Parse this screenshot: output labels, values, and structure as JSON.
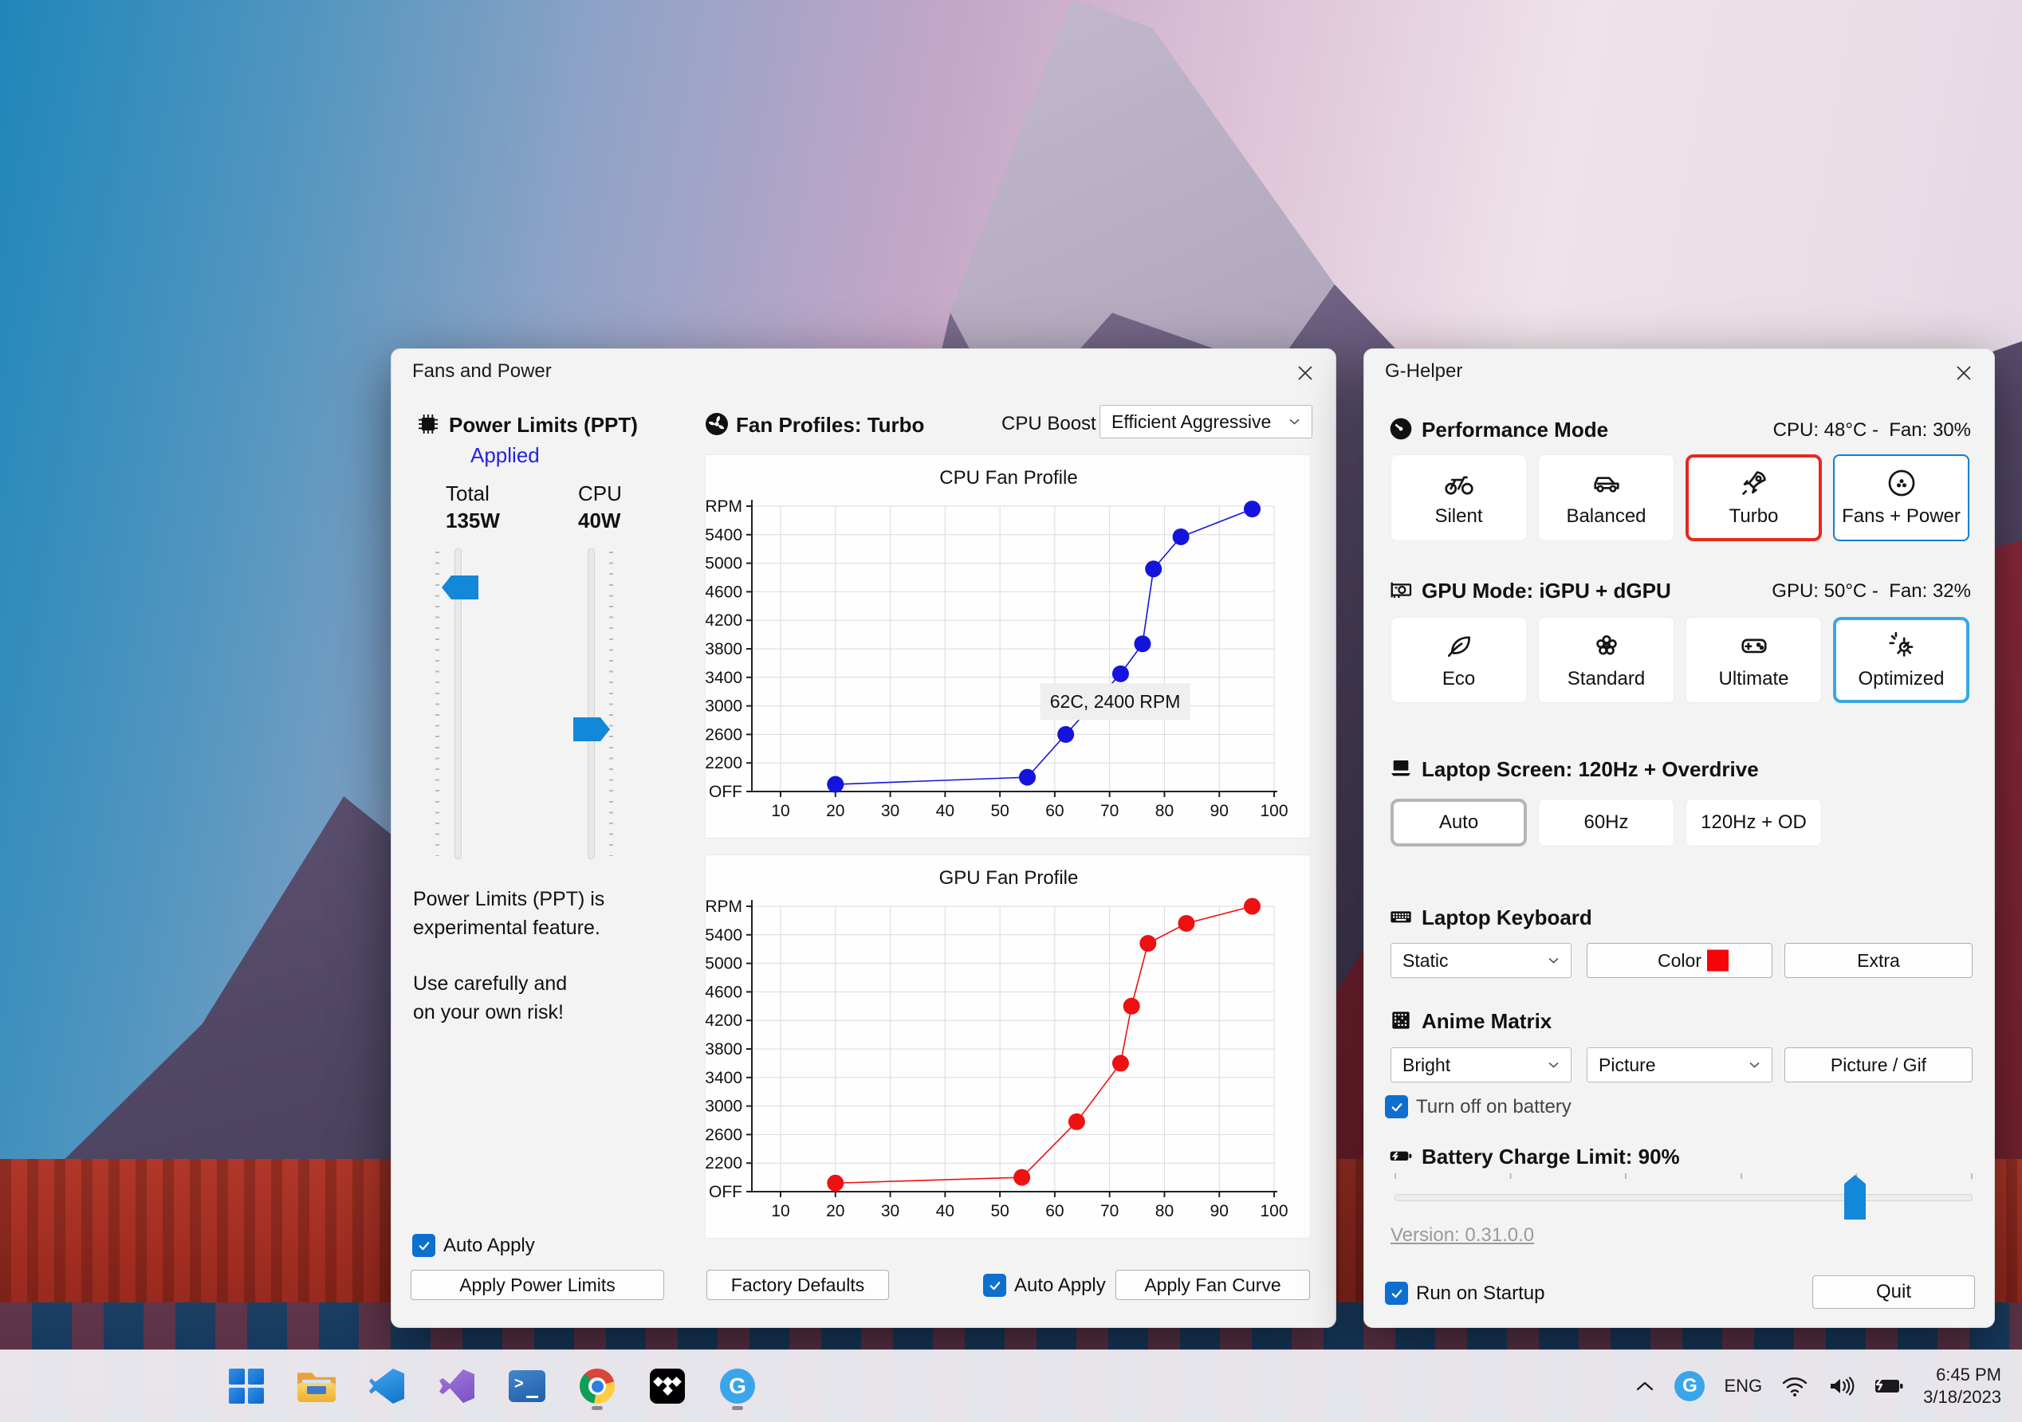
{
  "fans_window": {
    "title": "Fans and Power",
    "power": {
      "header": "Power Limits (PPT)",
      "status": "Applied",
      "total_label": "Total",
      "total_value": "135W",
      "cpu_label": "CPU",
      "cpu_value": "40W",
      "warning_line1": "Power Limits (PPT) is",
      "warning_line2": "experimental feature.",
      "warning_line3": "Use carefully and",
      "warning_line4": "on your own risk!",
      "auto_apply_label": "Auto Apply",
      "apply_button": "Apply Power Limits"
    },
    "profiles": {
      "header": "Fan Profiles: Turbo",
      "cpu_boost_label": "CPU Boost",
      "cpu_boost_value": "Efficient Aggressive",
      "factory_defaults_button": "Factory Defaults",
      "auto_apply_label": "Auto Apply",
      "apply_fan_curve_button": "Apply Fan Curve"
    }
  },
  "chart_data": [
    {
      "type": "line",
      "title": "CPU Fan Profile",
      "xlabel": "",
      "ylabel": "RPM",
      "grid": true,
      "x_ticks": [
        10,
        20,
        30,
        40,
        50,
        60,
        70,
        80,
        90,
        100
      ],
      "y_ticks": [
        {
          "label": "OFF",
          "value": 1800
        },
        {
          "label": "2200",
          "value": 2200
        },
        {
          "label": "2600",
          "value": 2600
        },
        {
          "label": "3000",
          "value": 3000
        },
        {
          "label": "3400",
          "value": 3400
        },
        {
          "label": "3800",
          "value": 3800
        },
        {
          "label": "4200",
          "value": 4200
        },
        {
          "label": "4600",
          "value": 4600
        },
        {
          "label": "5000",
          "value": 5000
        },
        {
          "label": "5400",
          "value": 5400
        },
        {
          "label": "RPM",
          "value": 5800
        }
      ],
      "series": [
        {
          "name": "CPU fan curve",
          "color": "#1414dd",
          "points": [
            [
              20,
              1900
            ],
            [
              55,
              2000
            ],
            [
              62,
              2600
            ],
            [
              72,
              3450
            ],
            [
              76,
              3870
            ],
            [
              78,
              4920
            ],
            [
              83,
              5370
            ],
            [
              96,
              5760
            ]
          ]
        }
      ],
      "annotation": {
        "text": "62C, 2400 RPM",
        "x": 71,
        "y": 3060
      }
    },
    {
      "type": "line",
      "title": "GPU Fan Profile",
      "xlabel": "",
      "ylabel": "RPM",
      "grid": true,
      "x_ticks": [
        10,
        20,
        30,
        40,
        50,
        60,
        70,
        80,
        90,
        100
      ],
      "y_ticks": [
        {
          "label": "OFF",
          "value": 1800
        },
        {
          "label": "2200",
          "value": 2200
        },
        {
          "label": "2600",
          "value": 2600
        },
        {
          "label": "3000",
          "value": 3000
        },
        {
          "label": "3400",
          "value": 3400
        },
        {
          "label": "3800",
          "value": 3800
        },
        {
          "label": "4200",
          "value": 4200
        },
        {
          "label": "4600",
          "value": 4600
        },
        {
          "label": "5000",
          "value": 5000
        },
        {
          "label": "5400",
          "value": 5400
        },
        {
          "label": "RPM",
          "value": 5800
        }
      ],
      "series": [
        {
          "name": "GPU fan curve",
          "color": "#ee1111",
          "points": [
            [
              20,
              1920
            ],
            [
              54,
              2000
            ],
            [
              64,
              2780
            ],
            [
              72,
              3600
            ],
            [
              74,
              4400
            ],
            [
              77,
              5280
            ],
            [
              84,
              5560
            ],
            [
              96,
              5800
            ]
          ]
        }
      ]
    }
  ],
  "ghelper_window": {
    "title": "G-Helper",
    "performance": {
      "header": "Performance Mode",
      "status": "CPU: 48°C -  Fan: 30%",
      "buttons": [
        {
          "label": "Silent"
        },
        {
          "label": "Balanced"
        },
        {
          "label": "Turbo",
          "selected": "red-border"
        },
        {
          "label": "Fans + Power",
          "selected": "blue-border"
        }
      ]
    },
    "gpu_mode": {
      "header": "GPU Mode: iGPU + dGPU",
      "status": "GPU: 50°C -  Fan: 32%",
      "buttons": [
        {
          "label": "Eco"
        },
        {
          "label": "Standard"
        },
        {
          "label": "Ultimate"
        },
        {
          "label": "Optimized",
          "selected": "sky-border"
        }
      ]
    },
    "screen": {
      "header": "Laptop Screen: 120Hz + Overdrive",
      "buttons": [
        {
          "label": "Auto",
          "selected": "gray-border"
        },
        {
          "label": "60Hz"
        },
        {
          "label": "120Hz + OD"
        }
      ]
    },
    "keyboard": {
      "header": "Laptop Keyboard",
      "mode_value": "Static",
      "color_button": "Color",
      "color_swatch": "#f40508",
      "extra_button": "Extra"
    },
    "anime_matrix": {
      "header": "Anime Matrix",
      "brightness_value": "Bright",
      "mode_value": "Picture",
      "picture_gif_button": "Picture / Gif",
      "turn_off_label": "Turn off on battery"
    },
    "battery": {
      "header": "Battery Charge Limit: 90%",
      "value_percent": 90
    },
    "version_link": "Version: 0.31.0.0",
    "run_on_startup_label": "Run on Startup",
    "quit_button": "Quit"
  },
  "taskbar": {
    "tray": {
      "language": "ENG",
      "time": "6:45 PM",
      "date": "3/18/2023"
    },
    "ghelper_badge": "G"
  },
  "colors": {
    "accent_blue": "#1387d8",
    "checkbox_blue": "#0d6fd0",
    "selected_red": "#e8281e",
    "selected_sky": "#38a7e8",
    "applied_link": "#2424e0"
  }
}
